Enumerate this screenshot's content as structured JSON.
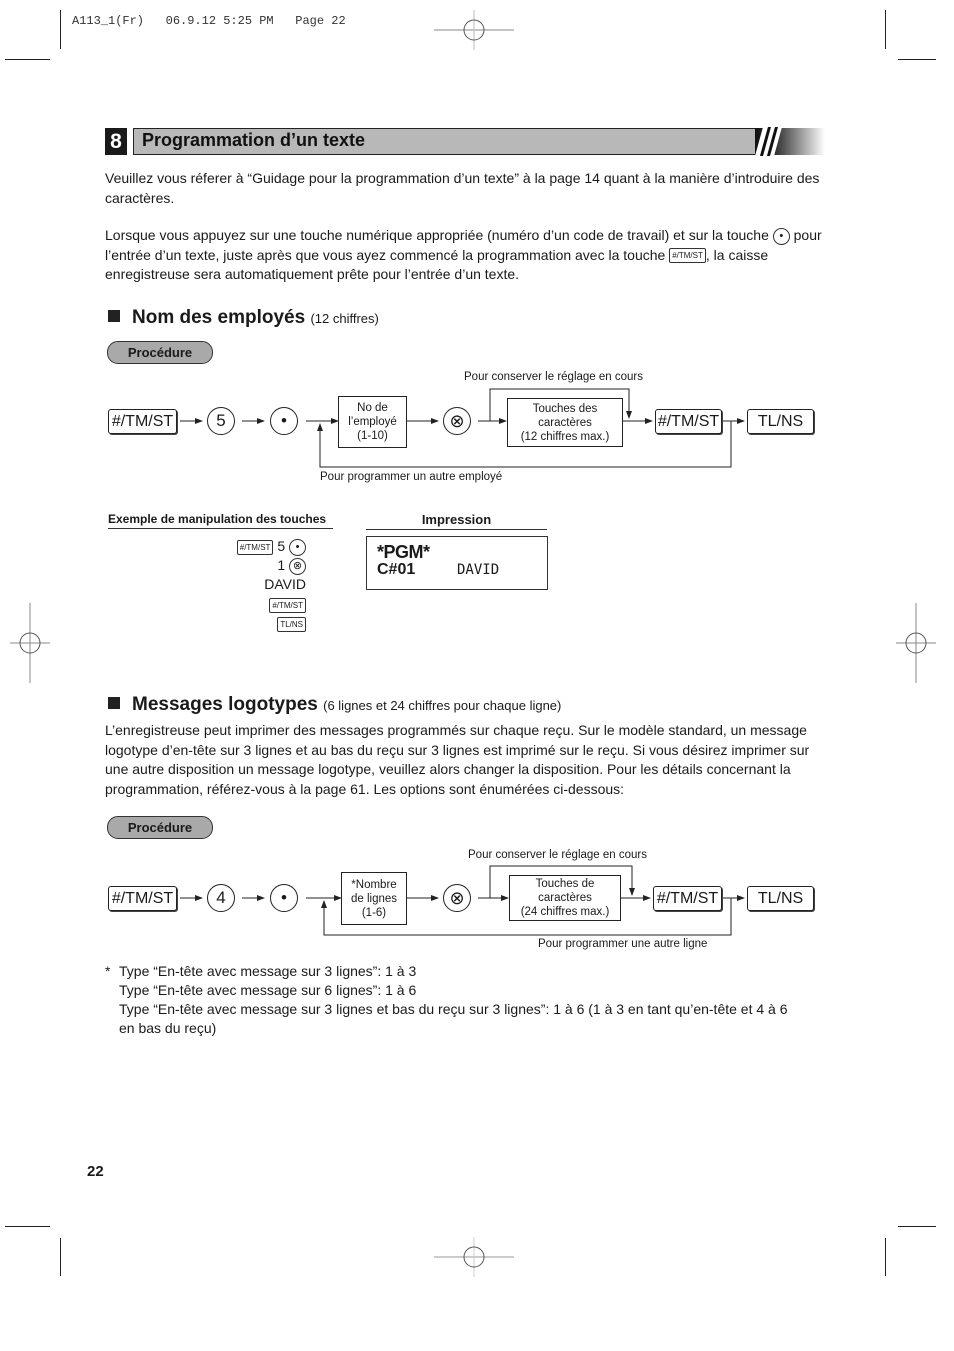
{
  "slug": "A113_1(Fr)   06.9.12 5:25 PM   Page 22",
  "section": {
    "number": "8",
    "title": "Programmation d’un texte"
  },
  "intro": {
    "p1": "Veuillez vous réferer à “Guidage pour la programmation d’un texte” à la page 14 quant à la manière d’introduire des caractères.",
    "p2_a": "Lorsque vous appuyez sur une touche numérique appropriée (numéro d’un code de travail) et sur la touche",
    "p2_b": "pour l’entrée d’un texte, juste après que vous ayez commencé la programmation avec la touche",
    "p2_c": ", la caisse enregistreuse sera automatiquement prête pour l’entrée d’un texte.",
    "key_point": "•",
    "key_tmst": "#/TM/ST"
  },
  "employees": {
    "heading": "Nom des employés",
    "subheading": "(12 chiffres)",
    "procedure_label": "Procédure",
    "flow": {
      "key1": "#/TM/ST",
      "key2": "5",
      "key3": "•",
      "box1": [
        "No de",
        "l’employé",
        "(1-10)"
      ],
      "mult": "⊗",
      "box2": [
        "Touches des",
        "caractères",
        "(12 chiffres max.)"
      ],
      "key4": "#/TM/ST",
      "key5": "TL/NS",
      "loop_top": "Pour conserver le réglage en cours",
      "loop_bottom": "Pour programmer un autre employé"
    },
    "example": {
      "heading": "Exemple de manipulation des touches",
      "line1_key": "#/TM/ST",
      "line1_num": "5",
      "line1_dot": "•",
      "line2_num": "1",
      "line2_mult": "⊗",
      "line3": "DAVID",
      "line4_key": "#/TM/ST",
      "line5_key": "TL/NS"
    },
    "print": {
      "heading": "Impression",
      "line1": "*PGM*",
      "line2_code": "C#01",
      "line2_name": "DAVID"
    }
  },
  "logos": {
    "heading": "Messages logotypes",
    "subheading": "(6 lignes et 24 chiffres pour chaque ligne)",
    "body": "L’enregistreuse peut imprimer des messages programmés sur chaque reçu. Sur le modèle standard, un message logotype d’en-tête sur 3 lignes et au bas du reçu sur 3 lignes est imprimé sur le reçu. Si vous désirez imprimer sur une autre disposition un message logotype, veuillez alors changer la disposition.  Pour les détails concernant la programmation, référez-vous à la page 61. Les options sont énumérées ci-dessous:",
    "procedure_label": "Procédure",
    "flow": {
      "key1": "#/TM/ST",
      "key2": "4",
      "key3": "•",
      "box1": [
        "*Nombre",
        "de lignes",
        "(1-6)"
      ],
      "mult": "⊗",
      "box2": [
        "Touches de",
        "caractères",
        "(24 chiffres max.)"
      ],
      "key4": "#/TM/ST",
      "key5": "TL/NS",
      "loop_top": "Pour conserver le réglage en cours",
      "loop_bottom": "Pour programmer une autre ligne"
    },
    "notes": {
      "marker": "*",
      "lines": [
        "Type “En-tête avec message sur 3 lignes”: 1 à 3",
        "Type “En-tête avec message sur 6 lignes”: 1 à 6",
        "Type “En-tête avec message sur 3 lignes et bas du reçu sur 3 lignes”: 1 à 6 (1 à 3 en tant qu’en-tête et 4 à 6",
        "en bas du reçu)"
      ]
    }
  },
  "page_number": "22"
}
